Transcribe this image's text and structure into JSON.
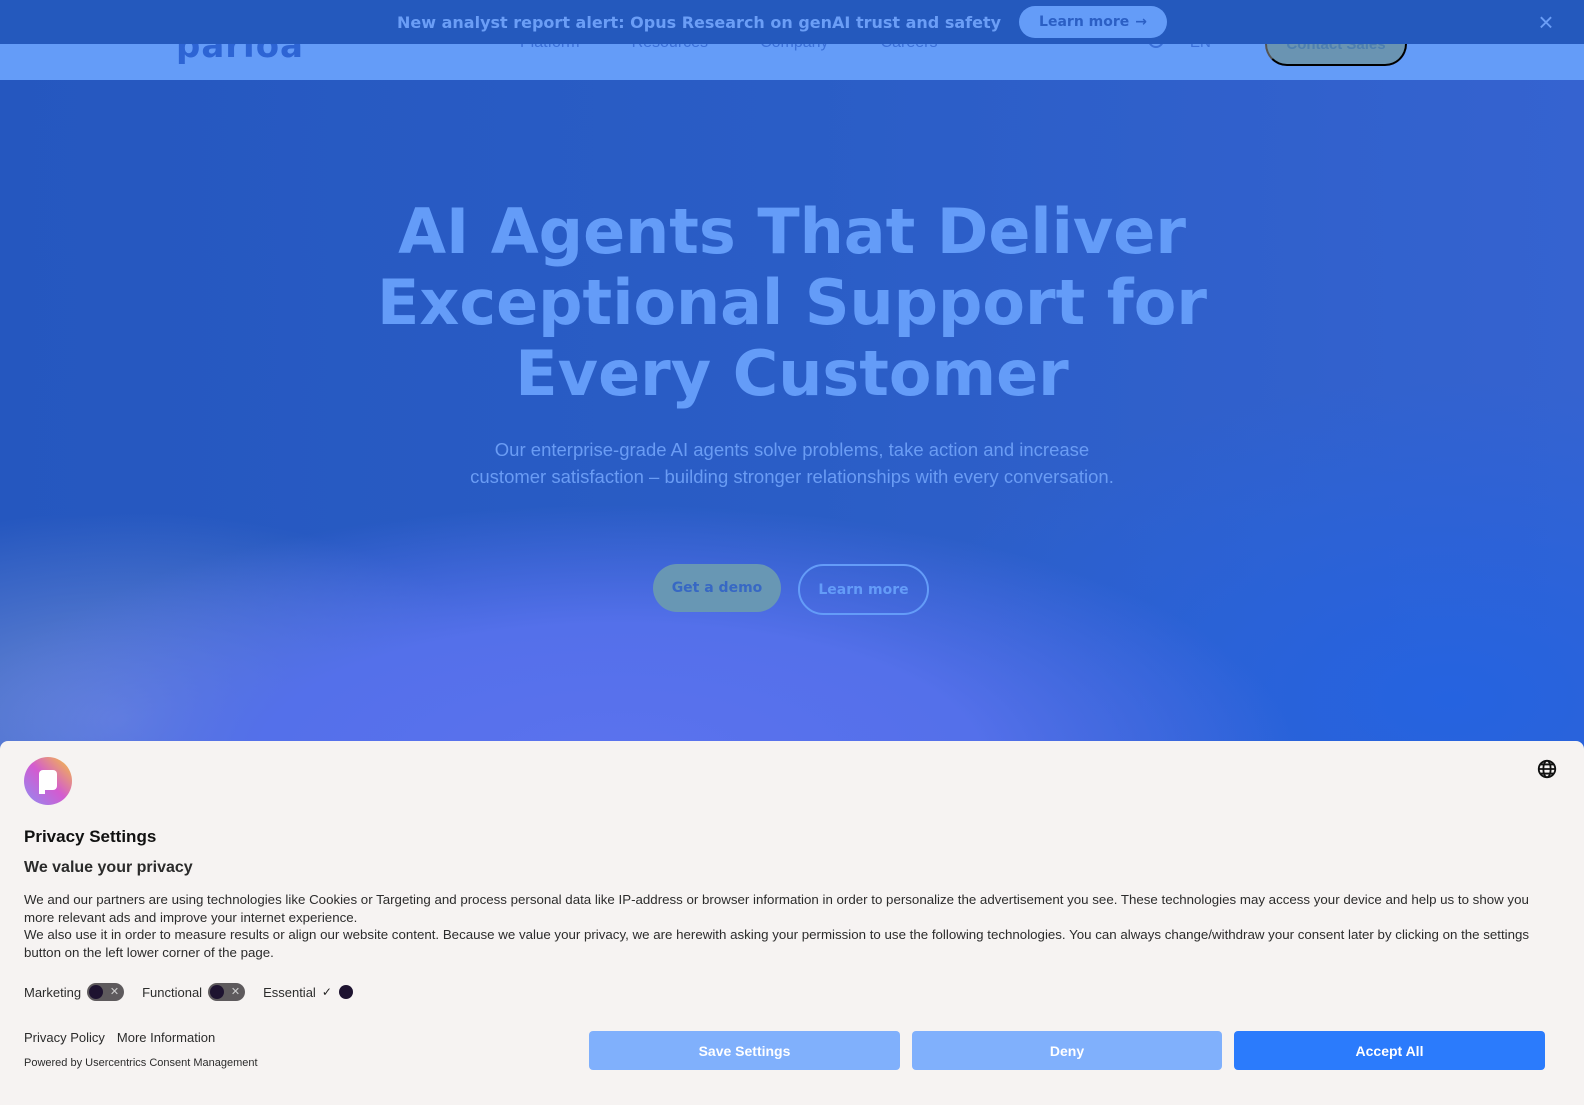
{
  "navbar": {
    "logo": "parloa",
    "links": [
      "Platform",
      "Resources",
      "Company",
      "Careers"
    ],
    "search_icon": "search-icon",
    "language": "EN",
    "contact_label": "Contact Sales"
  },
  "banner": {
    "text": "New analyst report alert: Opus Research on genAI trust and safety",
    "button_label": "Learn more",
    "button_icon": "→",
    "close_icon": "×"
  },
  "hero": {
    "title_lines": [
      "AI Agents That Deliver",
      "Exceptional Support for",
      "Every Customer"
    ],
    "subtitle": "Our enterprise-grade AI agents solve problems, take action and increase customer satisfaction – building stronger relationships with every conversation.",
    "primary_button": "Get a demo",
    "secondary_button": "Learn more"
  },
  "consent": {
    "title": "Privacy Settings",
    "subtitle": "We value your privacy",
    "body": [
      "We and our partners are using technologies like Cookies or Targeting and process personal data like IP-address or browser information in order to personalize the advertisement you see. These technologies may access your device and help us to show you more relevant ads and improve your internet experience.",
      "We also use it in order to measure results or align our website content. Because we value your privacy, we are herewith asking your permission to use the following technologies. You can always change/withdraw your consent later by clicking on the settings button on the left lower corner of the page."
    ],
    "toggles": [
      {
        "label": "Marketing",
        "enabled": false
      },
      {
        "label": "Functional",
        "enabled": false
      },
      {
        "label": "Essential",
        "enabled": true
      }
    ],
    "links": [
      "Privacy Policy",
      "More Information"
    ],
    "powered_by": "Powered by Usercentrics Consent Management",
    "buttons": {
      "save": "Save Settings",
      "deny": "Deny",
      "accept": "Accept All"
    },
    "colors": {
      "primary": "#2b7bfc",
      "secondary": "#80b0fc"
    }
  }
}
